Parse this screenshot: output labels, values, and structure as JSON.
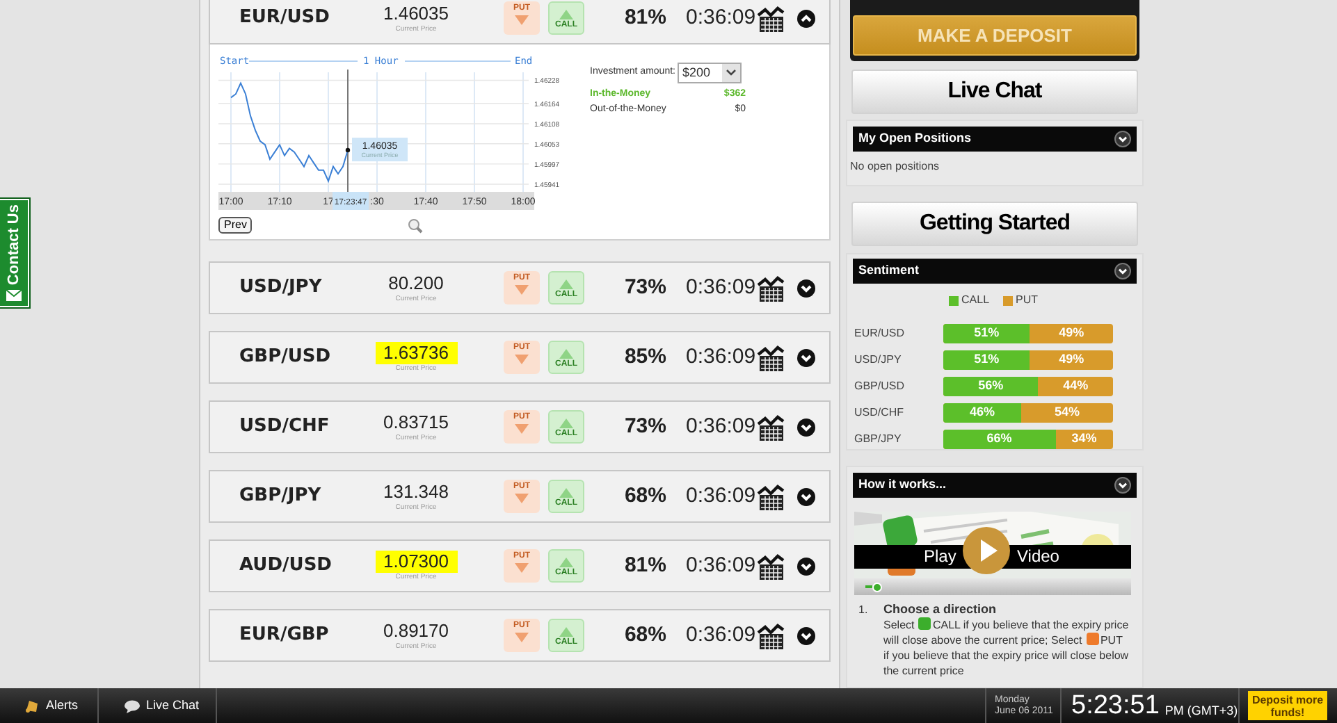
{
  "contact_tab": {
    "label": "Contact Us"
  },
  "assets": [
    {
      "pair": "EUR/USD",
      "price": "1.46035",
      "caption": "Current Price",
      "highlighted": false,
      "put": "PUT",
      "call": "CALL",
      "disabled": true,
      "payout": "81%",
      "expiry": "0:36:09",
      "expanded": true
    },
    {
      "pair": "USD/JPY",
      "price": "80.200",
      "caption": "Current Price",
      "highlighted": false,
      "put": "PUT",
      "call": "CALL",
      "disabled": true,
      "payout": "73%",
      "expiry": "0:36:09",
      "expanded": false
    },
    {
      "pair": "GBP/USD",
      "price": "1.63736",
      "caption": "Current Price",
      "highlighted": true,
      "put": "PUT",
      "call": "CALL",
      "disabled": true,
      "payout": "85%",
      "expiry": "0:36:09",
      "expanded": false
    },
    {
      "pair": "USD/CHF",
      "price": "0.83715",
      "caption": "Current Price",
      "highlighted": false,
      "put": "PUT",
      "call": "CALL",
      "disabled": true,
      "payout": "73%",
      "expiry": "0:36:09",
      "expanded": false
    },
    {
      "pair": "GBP/JPY",
      "price": "131.348",
      "caption": "Current Price",
      "highlighted": false,
      "put": "PUT",
      "call": "CALL",
      "disabled": true,
      "payout": "68%",
      "expiry": "0:36:09",
      "expanded": false
    },
    {
      "pair": "AUD/USD",
      "price": "1.07300",
      "caption": "Current Price",
      "highlighted": true,
      "put": "PUT",
      "call": "CALL",
      "disabled": true,
      "payout": "81%",
      "expiry": "0:36:09",
      "expanded": false
    },
    {
      "pair": "EUR/GBP",
      "price": "0.89170",
      "caption": "Current Price",
      "highlighted": false,
      "put": "PUT",
      "call": "CALL",
      "disabled": true,
      "payout": "68%",
      "expiry": "0:36:09",
      "expanded": false
    }
  ],
  "trade_panel": {
    "chart_header": {
      "start": "Start",
      "middle": "1 Hour",
      "end": "End"
    },
    "cursor_time": "17:23:47",
    "callout": {
      "price": "1.46035",
      "caption": "Current Price"
    },
    "prev_button": "Prev",
    "chart_data": {
      "type": "line",
      "categories": [
        "17:00",
        null,
        null,
        null,
        null,
        null,
        null,
        null,
        null,
        null,
        "17:10",
        null,
        null,
        null,
        null,
        null,
        null,
        null,
        null,
        null,
        "17",
        null,
        null,
        null,
        null,
        null,
        null,
        null,
        null,
        null,
        ":30",
        null,
        null,
        null,
        null,
        null,
        null,
        null,
        null,
        null,
        "17:40",
        null,
        null,
        null,
        null,
        null,
        null,
        null,
        null,
        null,
        "17:50",
        null,
        null,
        null,
        null,
        null,
        null,
        null,
        null,
        null,
        "18:00"
      ],
      "series": [
        {
          "color": "#3a7fd5",
          "values": [
            1.4618,
            1.4619,
            1.4622,
            1.4619,
            1.4613,
            1.4609,
            1.4606,
            1.4605,
            1.4601,
            1.4603,
            1.4605,
            1.4602,
            1.4604,
            1.4603,
            1.4601,
            1.4599,
            1.4602,
            1.46,
            1.4598,
            1.4598,
            1.4595,
            1.4599,
            1.4597,
            1.4599,
            1.46035,
            null,
            null,
            null,
            null,
            null,
            null,
            null,
            null,
            null,
            null,
            null,
            null,
            null,
            null,
            null,
            null,
            null,
            null,
            null,
            null,
            null,
            null,
            null,
            null,
            null,
            null,
            null,
            null,
            null,
            null,
            null,
            null,
            null,
            null,
            null,
            null
          ]
        }
      ],
      "ylim": [
        1.4592,
        1.4625
      ],
      "grid": true,
      "yticks": [
        {
          "value": 1.46228,
          "label": "1.46228"
        },
        {
          "value": 1.46164,
          "label": "1.46164"
        },
        {
          "value": 1.46108,
          "label": "1.46108"
        },
        {
          "value": 1.46053,
          "label": "1.46053"
        },
        {
          "value": 1.45997,
          "label": "1.45997"
        },
        {
          "value": 1.45941,
          "label": "1.45941"
        }
      ]
    },
    "investment": {
      "label": "Investment amount:",
      "value": "$200"
    },
    "outcomes": [
      {
        "label": "In-the-Money",
        "amount": "$362",
        "kind": "win"
      },
      {
        "label": "Out-of-the-Money",
        "amount": "$0",
        "kind": "loss"
      }
    ]
  },
  "sidebar": {
    "deposit_button": "MAKE A DEPOSIT",
    "live_chat_button": "Live Chat",
    "open_positions": {
      "title": "My Open Positions",
      "message": "No open positions"
    },
    "getting_started_button": "Getting Started",
    "sentiment": {
      "title": "Sentiment",
      "legend": [
        {
          "label": "CALL",
          "color": "#5cbf2a"
        },
        {
          "label": "PUT",
          "color": "#d89b2b"
        }
      ],
      "rows": [
        {
          "pair": "EUR/USD",
          "level": 0.51,
          "call": "51%",
          "put": "49%"
        },
        {
          "pair": "USD/JPY",
          "level": 0.51,
          "call": "51%",
          "put": "49%"
        },
        {
          "pair": "GBP/USD",
          "level": 0.56,
          "call": "56%",
          "put": "44%"
        },
        {
          "pair": "USD/CHF",
          "level": 0.46,
          "call": "46%",
          "put": "54%"
        },
        {
          "pair": "GBP/JPY",
          "level": 0.66,
          "call": "66%",
          "put": "34%"
        }
      ]
    },
    "how_it_works": {
      "title": "How it works...",
      "video": {
        "kind": "picture",
        "play": "Play",
        "label": "Video",
        "level": 0.03
      },
      "steps": [
        {
          "number": "1.",
          "title": "Choose a direction",
          "parts": [
            {
              "kind": "text",
              "text": "Select"
            },
            {
              "kind": "call_icon"
            },
            {
              "kind": "text",
              "text": "CALL if you believe that the expiry price will close above the current price; Select"
            },
            {
              "kind": "put_icon"
            },
            {
              "kind": "text",
              "text": "PUT if you believe that the expiry price will close below the current price"
            }
          ]
        }
      ]
    }
  },
  "bottom_bar": {
    "tabs": [
      {
        "label": "Alerts",
        "kind": "alerts"
      },
      {
        "label": "Live Chat",
        "kind": "chat"
      }
    ],
    "day": "Monday",
    "date": "June 06 2011",
    "time": "5:23:51",
    "zone": "PM (GMT+3)",
    "deposit_button": "Deposit more funds!"
  }
}
